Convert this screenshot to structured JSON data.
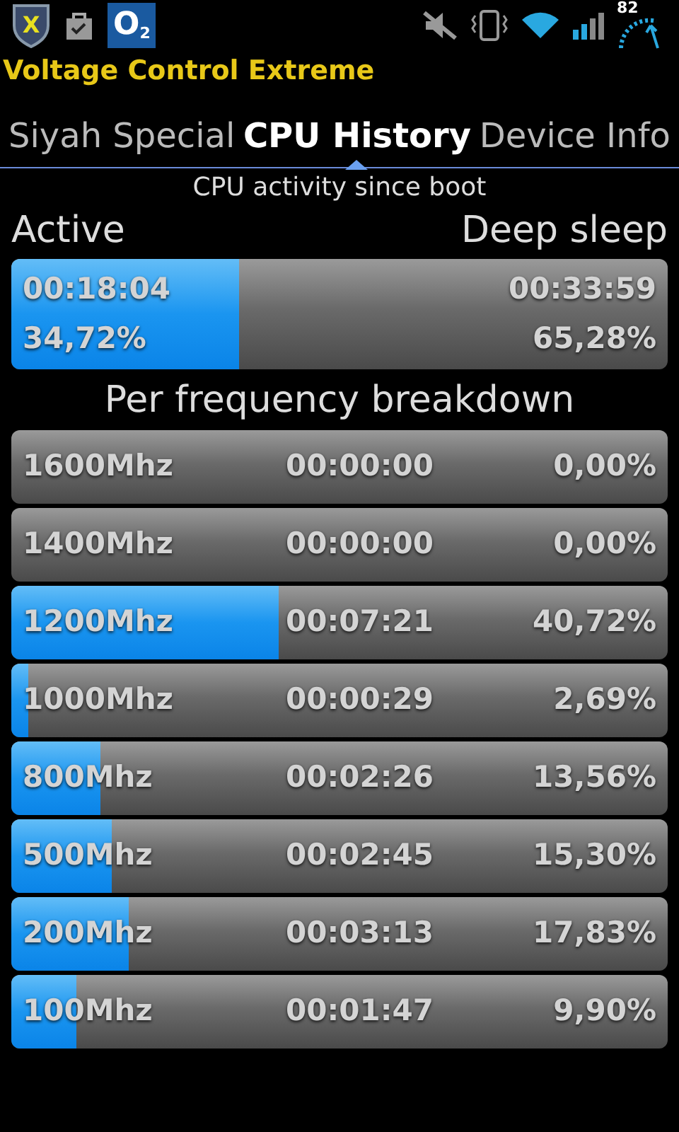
{
  "status_bar": {
    "app_icon_letter": "X",
    "carrier_logo": "O$_{2}$",
    "battery": "82"
  },
  "app_title": "Voltage Control Extreme",
  "tabs": [
    {
      "label": "Siyah Special",
      "selected": false
    },
    {
      "label": "CPU History",
      "selected": true
    },
    {
      "label": "Device Info",
      "selected": false
    }
  ],
  "subtitle": "CPU activity since boot",
  "summary": {
    "left_label": "Active",
    "right_label": "Deep sleep",
    "level": 0.3472,
    "active_time": "00:18:04",
    "active_percent": "34,72%",
    "sleep_time": "00:33:59",
    "sleep_percent": "65,28%"
  },
  "breakdown_title": "Per frequency breakdown",
  "frequencies": [
    {
      "frequency": "1600Mhz",
      "time": "00:00:00",
      "percent": "0,00%"
    },
    {
      "frequency": "1400Mhz",
      "time": "00:00:00",
      "percent": "0,00%"
    },
    {
      "frequency": "1200Mhz",
      "time": "00:07:21",
      "percent": "40,72%",
      "level": 0.4072
    },
    {
      "frequency": "1000Mhz",
      "time": "00:00:29",
      "percent": "2,69%",
      "level": 0.0269
    },
    {
      "frequency": "800Mhz",
      "time": "00:02:26",
      "percent": "13,56%",
      "level": 0.1356
    },
    {
      "frequency": "500Mhz",
      "time": "00:02:45",
      "percent": "15,30%",
      "level": 0.153
    },
    {
      "frequency": "200Mhz",
      "time": "00:03:13",
      "percent": "17,83%",
      "level": 0.1783
    },
    {
      "frequency": "100Mhz",
      "time": "00:01:47",
      "percent": "9,90%",
      "level": 0.099
    }
  ]
}
